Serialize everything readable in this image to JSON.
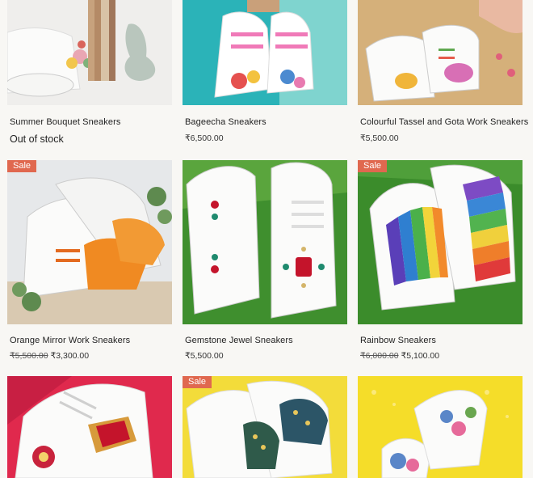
{
  "products": [
    {
      "name": "Summer Bouquet Sneakers",
      "status": "Out of stock",
      "badge": "",
      "price": "",
      "compare_price": ""
    },
    {
      "name": "Bageecha Sneakers",
      "status": "",
      "badge": "",
      "price": "₹6,500.00",
      "compare_price": ""
    },
    {
      "name": "Colourful Tassel and Gota Work Sneakers",
      "status": "",
      "badge": "",
      "price": "₹5,500.00",
      "compare_price": ""
    },
    {
      "name": "Orange Mirror Work Sneakers",
      "status": "",
      "badge": "Sale",
      "price": "₹3,300.00",
      "compare_price": "₹5,500.00"
    },
    {
      "name": "Gemstone Jewel Sneakers",
      "status": "",
      "badge": "",
      "price": "₹5,500.00",
      "compare_price": ""
    },
    {
      "name": "Rainbow Sneakers",
      "status": "",
      "badge": "Sale",
      "price": "₹5,100.00",
      "compare_price": "₹6,000.00"
    },
    {
      "name": "",
      "status": "",
      "badge": "",
      "price": "",
      "compare_price": ""
    },
    {
      "name": "",
      "status": "",
      "badge": "Sale",
      "price": "",
      "compare_price": ""
    },
    {
      "name": "",
      "status": "",
      "badge": "",
      "price": "",
      "compare_price": ""
    }
  ]
}
